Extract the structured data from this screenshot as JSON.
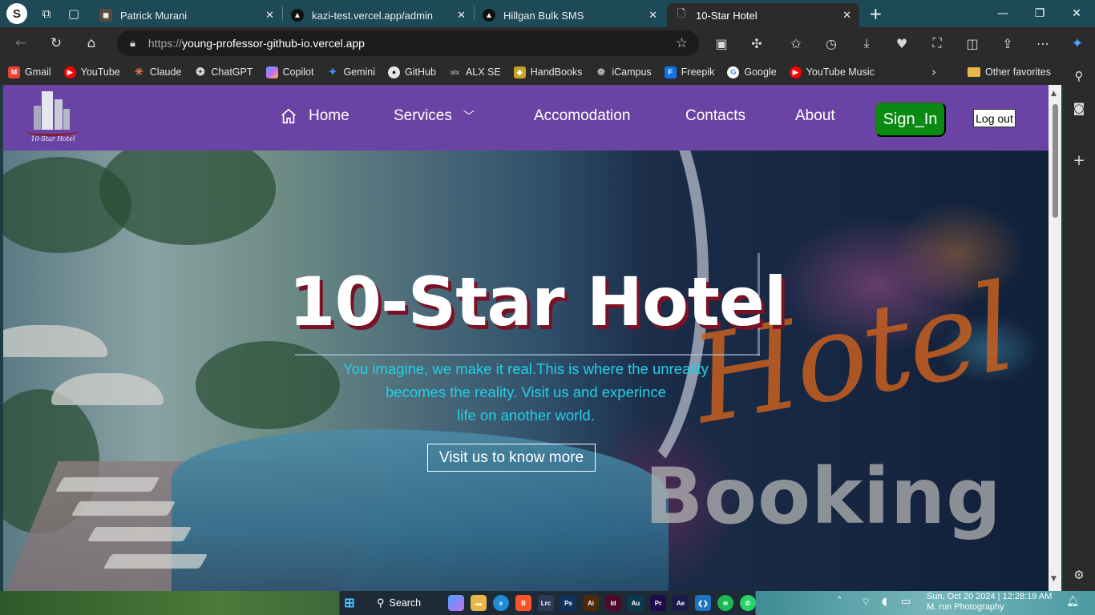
{
  "browser": {
    "profile_initial": "S",
    "tabs": [
      {
        "title": "Patrick Murani",
        "favicon": "portrait-icon",
        "active": false
      },
      {
        "title": "kazi-test.vercel.app/admin",
        "favicon": "vercel-triangle-icon",
        "active": false
      },
      {
        "title": "Hillgan Bulk SMS",
        "favicon": "vercel-triangle-icon",
        "active": false
      },
      {
        "title": "10-Star Hotel",
        "favicon": "page-icon",
        "active": true
      }
    ],
    "url_scheme": "https://",
    "url_host": "young-professor-github-io.vercel.app",
    "bookmarks": [
      {
        "label": "Gmail",
        "icon": "gmail-icon",
        "color": "#ea4335"
      },
      {
        "label": "YouTube",
        "icon": "youtube-icon",
        "color": "#ff0000"
      },
      {
        "label": "Claude",
        "icon": "claude-icon",
        "color": "#d97757"
      },
      {
        "label": "ChatGPT",
        "icon": "chatgpt-icon",
        "color": "#444444"
      },
      {
        "label": "Copilot",
        "icon": "copilot-icon",
        "color": "#7b61ff"
      },
      {
        "label": "Gemini",
        "icon": "gemini-icon",
        "color": "#4a8af4"
      },
      {
        "label": "GitHub",
        "icon": "github-icon",
        "color": "#333333"
      },
      {
        "label": "ALX SE",
        "icon": "alx-icon",
        "color": "#555555"
      },
      {
        "label": "HandBooks",
        "icon": "handbooks-icon",
        "color": "#c9a227"
      },
      {
        "label": "iCampus",
        "icon": "icampus-icon",
        "color": "#777777"
      },
      {
        "label": "Freepik",
        "icon": "freepik-icon",
        "color": "#1273eb"
      },
      {
        "label": "Google",
        "icon": "google-icon",
        "color": "#4285f4"
      },
      {
        "label": "YouTube Music",
        "icon": "youtube-music-icon",
        "color": "#ff0000"
      }
    ],
    "other_favorites": "Other favorites"
  },
  "site": {
    "logo_text": "10-Star Hotel",
    "nav": {
      "home": "Home",
      "services": "Services",
      "accomodation": "Accomodation",
      "contacts": "Contacts",
      "about": "About"
    },
    "signin_label": "Sign_In",
    "logout_label": "Log out",
    "brand_color": "#6a44a4",
    "signin_color": "#0a8a12"
  },
  "hero": {
    "title": "10-Star Hotel",
    "tagline_line1": "You imagine, we make it real.This is where the unreality",
    "tagline_line2": "becomes the reality. Visit us and experince",
    "tagline_line3": "life on another world.",
    "cta_label": "Visit us to know more",
    "background_word1": "Hotel",
    "background_word2": "Booking",
    "tagline_color": "#23d0e6"
  },
  "taskbar": {
    "search_label": "Search",
    "clock_line1": "Sun, Oct 20 2024 | 12:28:19 AM",
    "clock_line2": "M. run Photography",
    "apps": [
      {
        "abbr": "Lrc",
        "color": "#2b3a55"
      },
      {
        "abbr": "Ps",
        "color": "#0f2f5c"
      },
      {
        "abbr": "Ai",
        "color": "#4a2c0a"
      },
      {
        "abbr": "Id",
        "color": "#4d0b2b"
      },
      {
        "abbr": "Au",
        "color": "#0b3a4d"
      },
      {
        "abbr": "Pr",
        "color": "#1e0b4d"
      },
      {
        "abbr": "Ae",
        "color": "#1a1a4d"
      }
    ]
  }
}
